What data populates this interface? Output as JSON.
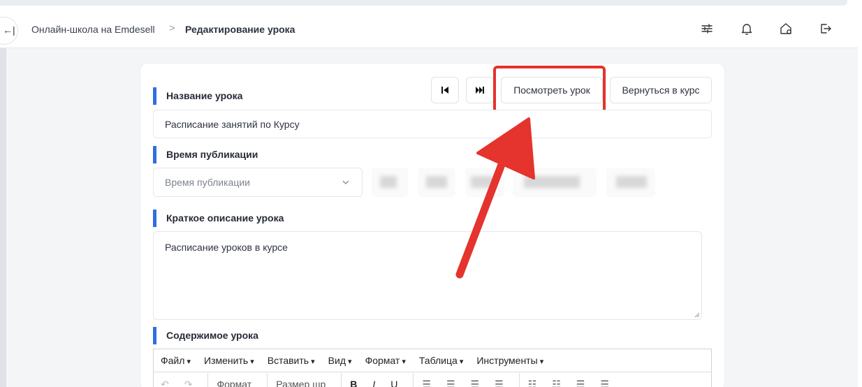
{
  "header": {
    "breadcrumb_root": "Онлайн-школа на Emdesell",
    "breadcrumb_separator": ">",
    "breadcrumb_current": "Редактирование урока",
    "collapse_glyph": "←|",
    "icons": [
      "sliders-icon",
      "bell-icon",
      "home-settings-icon",
      "logout-icon"
    ]
  },
  "lesson": {
    "nav_prev_glyph": "⏮",
    "nav_next_glyph": "⏭",
    "view_button": "Посмотреть урок",
    "back_button": "Вернуться в курс",
    "title_label": "Название урока",
    "title_value": "Расписание занятий по Курсу",
    "publish_label": "Время публикации",
    "publish_placeholder": "Время публикации",
    "description_label": "Краткое описание урока",
    "description_value": "Расписание уроков в курсе",
    "content_label": "Содержимое урока"
  },
  "editor": {
    "menus": [
      "Файл",
      "Изменить",
      "Вставить",
      "Вид",
      "Формат",
      "Таблица",
      "Инструменты"
    ],
    "toolbar": {
      "undo": "↶",
      "redo": "↷",
      "format_select": "Формат",
      "size_select": "Размер шр",
      "bold": "B",
      "italic": "I",
      "underline": "U"
    }
  },
  "colors": {
    "accent": "#2f6fe0",
    "highlight": "#e5322d"
  }
}
